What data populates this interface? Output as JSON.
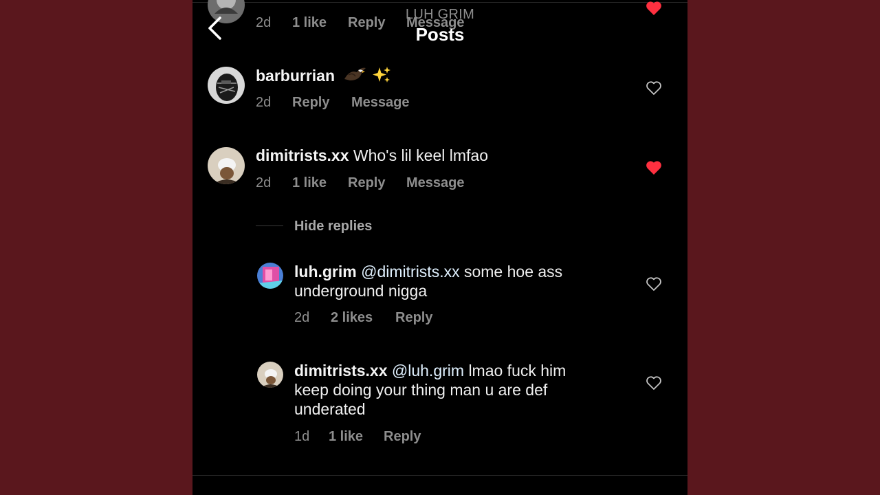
{
  "header": {
    "kicker": "LUH GRIM",
    "title": "Posts"
  },
  "colors": {
    "outer_background": "#5a171d",
    "screen_background": "#000000",
    "like_red": "#ff3040",
    "meta_gray": "#8e8e8e"
  },
  "comments": [
    {
      "meta": {
        "age": "2d",
        "likes": "1 like",
        "reply": "Reply",
        "message": "Message"
      },
      "liked": true
    },
    {
      "username": "barburrian",
      "text": "",
      "emoji": [
        "eagle",
        "sparkles"
      ],
      "meta": {
        "age": "2d",
        "reply": "Reply",
        "message": "Message"
      },
      "liked": false
    },
    {
      "username": "dimitrists.xx",
      "text": "Who's lil keel lmfao",
      "meta": {
        "age": "2d",
        "likes": "1 like",
        "reply": "Reply",
        "message": "Message"
      },
      "liked": true
    }
  ],
  "replies_toggle": "Hide replies",
  "replies": [
    {
      "username": "luh.grim",
      "mention": "@dimitrists.xx",
      "line1": "some hoe ass",
      "line2": "underground nigga",
      "meta": {
        "age": "2d",
        "likes": "2 likes",
        "reply": "Reply"
      },
      "liked": false
    },
    {
      "username": "dimitrists.xx",
      "mention": "@luh.grim",
      "line1": "lmao fuck him",
      "line2": "keep doing your thing man u are def",
      "line3": "underated",
      "meta": {
        "age": "1d",
        "likes": "1 like",
        "reply": "Reply"
      },
      "liked": false
    }
  ]
}
